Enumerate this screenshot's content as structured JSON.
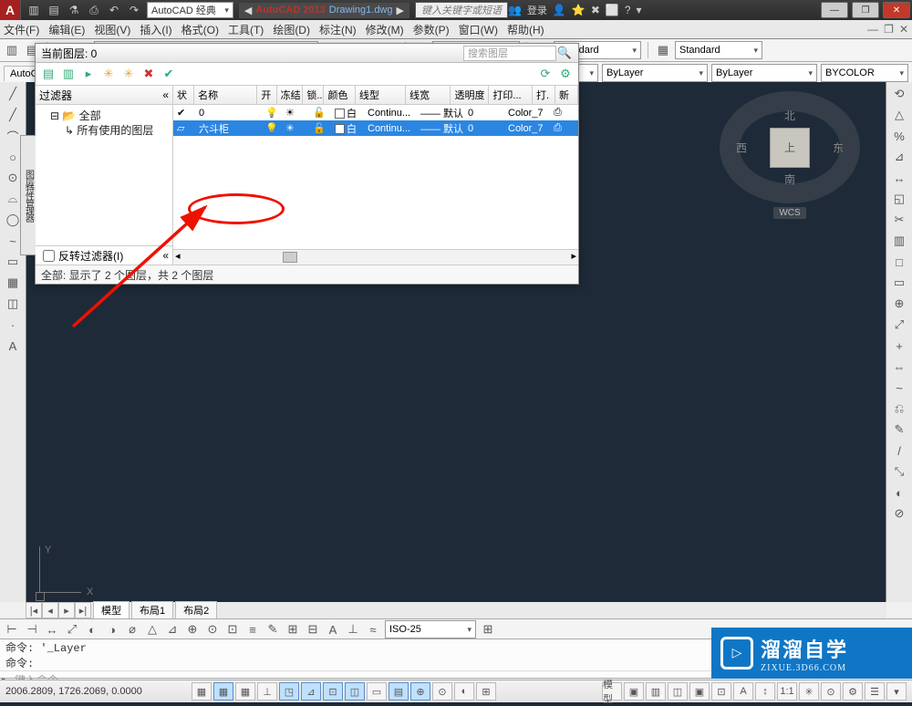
{
  "app": {
    "logo_letter": "A",
    "name": "AutoCAD 2013",
    "file": "Drawing1.dwg",
    "workspace": "AutoCAD 经典",
    "search_hint": "键入关键字或短语",
    "login": "登录"
  },
  "qat_icons": [
    "▥",
    "▤",
    "⚗",
    "⎙",
    "↶",
    "↷"
  ],
  "title_right_icons": [
    "👤",
    "⭐",
    "✖",
    "⬜",
    "?",
    "▾"
  ],
  "window_buttons": {
    "min": "—",
    "max": "❐",
    "close": "✕"
  },
  "menu": [
    "文件(F)",
    "编辑(E)",
    "视图(V)",
    "插入(I)",
    "格式(O)",
    "工具(T)",
    "绘图(D)",
    "标注(N)",
    "修改(M)",
    "参数(P)",
    "窗口(W)",
    "帮助(H)"
  ],
  "menu_tail": [
    "—",
    "❐",
    "✕"
  ],
  "props_row": {
    "layer_value": "",
    "dim_style": "ISO-25",
    "text_style": "Standard",
    "table_style": "Standard",
    "color": "ByLayer",
    "ltype": "ByLayer",
    "lweight": "ByLayer",
    "plot": "BYCOLOR"
  },
  "left_palette": [
    "╱",
    "╱",
    "⌒",
    "○",
    "⊙",
    "⌓",
    "◯",
    "~",
    "▭",
    "▦",
    "◫",
    "·",
    "A"
  ],
  "right_palette": [
    "⟲",
    "△",
    "%",
    "⊿",
    "↔",
    "◱",
    "✂",
    "▥",
    "□",
    "▭",
    "⊕",
    "⤢",
    "+",
    "⇔",
    "~",
    "⎌",
    "✎",
    "/",
    "⤡",
    "◐",
    "⊘"
  ],
  "viewcube": {
    "n": "北",
    "s": "南",
    "e": "东",
    "w": "西",
    "face": "上",
    "wcs": "WCS"
  },
  "ucs": {
    "x": "X",
    "y": "Y"
  },
  "layer_dlg": {
    "current_layer_label": "当前图层: 0",
    "search_placeholder": "搜索图层",
    "filter_header": "过滤器",
    "tree_root": "全部",
    "tree_child": "所有使用的图层",
    "invert_filter": "反转过滤器(I)",
    "status_text": "全部: 显示了 2 个图层，共 2 个图层",
    "side_tab": "图层特性管理器",
    "tool_icons_left": [
      "▤",
      "▥",
      "▸"
    ],
    "tool_icons_mid": [
      "✳",
      "✳",
      "✖",
      "✔"
    ],
    "tool_icons_right": [
      "⟳",
      "⚙"
    ],
    "cols": [
      "状",
      "名称",
      "开",
      "冻结",
      "锁...",
      "颜色",
      "线型",
      "线宽",
      "透明度",
      "打印...",
      "打.",
      "新"
    ],
    "rows": [
      {
        "status": "✔",
        "name": "0",
        "on": "💡",
        "freeze": "☀",
        "lock": "🔓",
        "color_sw": "#ffffff",
        "color": "白",
        "ltype": "Continu...",
        "lweight": "—— 默认",
        "trans": "0",
        "pstyle": "Color_7",
        "plot": "⎙",
        "selected": false
      },
      {
        "status": "▱",
        "name": "六斗柜",
        "on": "💡",
        "freeze": "☀",
        "lock": "🔓",
        "color_sw": "#ffffff",
        "color": "白",
        "ltype": "Continu...",
        "lweight": "—— 默认",
        "trans": "0",
        "pstyle": "Color_7",
        "plot": "⎙",
        "selected": true
      }
    ]
  },
  "layout_tabs": {
    "nav": [
      "|◂",
      "◂",
      "▸",
      "▸|"
    ],
    "tabs": [
      "模型",
      "布局1",
      "布局2"
    ],
    "active": 0
  },
  "dim_toolbar_icons": [
    "⊢",
    "⊣",
    "↔",
    "⤢",
    "◐",
    "◑",
    "⌀",
    "△",
    "⊿",
    "⊕",
    "⊙",
    "⊡",
    "≡",
    "✎",
    "⊞",
    "⊟",
    "A",
    "⊥",
    "≈"
  ],
  "dim_dd": "ISO-25",
  "command": {
    "line1": "命令: '_Layer",
    "line2": "命令:",
    "prompt_caret": "▸",
    "prompt_placeholder": "鍵入命令"
  },
  "status": {
    "coords": "2006.2809, 1726.2069, 0.0000",
    "toggles": [
      {
        "ic": "▦",
        "on": false
      },
      {
        "ic": "▦",
        "on": true
      },
      {
        "ic": "▦",
        "on": false
      },
      {
        "ic": "⊥",
        "on": false
      },
      {
        "ic": "◳",
        "on": true
      },
      {
        "ic": "⊿",
        "on": true
      },
      {
        "ic": "⊡",
        "on": true
      },
      {
        "ic": "◫",
        "on": true
      },
      {
        "ic": "▭",
        "on": false
      },
      {
        "ic": "▤",
        "on": true
      },
      {
        "ic": "⊕",
        "on": true
      },
      {
        "ic": "⊙",
        "on": false
      },
      {
        "ic": "◐",
        "on": false
      },
      {
        "ic": "⊞",
        "on": false
      }
    ],
    "right": [
      "模型",
      "▣",
      "▥",
      "◫",
      "▣",
      "⊡",
      "A",
      "↕",
      "1:1",
      "✳",
      "⊙",
      "⚙",
      "☰",
      "▾"
    ]
  },
  "watermark": {
    "big": "溜溜自学",
    "small": "ZIXUE.3D66.COM"
  }
}
